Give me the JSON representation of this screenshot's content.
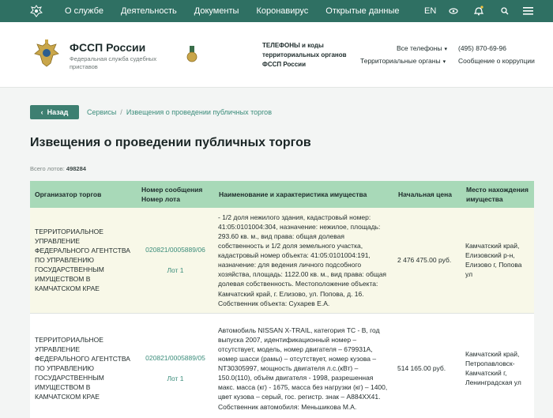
{
  "nav": {
    "items": [
      "О службе",
      "Деятельность",
      "Документы",
      "Коронавирус",
      "Открытые данные"
    ],
    "lang": "EN"
  },
  "header": {
    "org_name": "ФССП России",
    "org_sub": "Федеральная служба судебных приставов",
    "phones_title": "ТЕЛЕФОНЫ и коды территориальных органов ФССП России",
    "all_phones": "Все телефоны",
    "territorial": "Территориальные органы",
    "phone": "(495) 870-69-96",
    "report": "Сообщение о коррупции"
  },
  "breadcrumb": {
    "back": "Назад",
    "items": [
      "Сервисы",
      "Извещения о проведении публичных торгов"
    ]
  },
  "page": {
    "title": "Извещения о проведении публичных торгов",
    "total_label": "Всего лотов:",
    "total_value": "498284"
  },
  "table": {
    "headers": [
      "Организатор торгов",
      "Номер сообщения Номер лота",
      "Наименование и характеристика имущества",
      "Начальная цена",
      "Место нахождения имущества"
    ],
    "rows": [
      {
        "organizer": "Территориальное управление Федерального агентства по управлению государственным имуществом в Камчатском крае",
        "message_no": "020821/0005889/06",
        "lot": "Лот 1",
        "description": "- 1/2 доля нежилого здания, кадастровый номер: 41:05:0101004:304, назначение: нежилое, площадь: 293.60 кв. м., вид права: общая долевая собственность и 1/2 доля земельного участка, кадастровый номер объекта: 41:05:0101004:191, назначение: для ведения личного подсобного хозяйства, площадь: 1122.00 кв. м., вид права: общая долевая собственность. Местоположение объекта: Камчатский край, г. Елизово, ул. Попова, д. 16. Собственник объекта: Сухарев Е.А.",
        "price": "2 476 475.00 руб.",
        "location": "Камчатский край, Елизовский р-н, Елизово г, Попова ул"
      },
      {
        "organizer": "Территориальное управление Федерального агентства по управлению государственным имуществом в Камчатском крае",
        "message_no": "020821/0005889/05",
        "lot": "Лот 1",
        "description": "Автомобиль NISSAN X-TRAIL, категория ТС - В, год выпуска 2007, идентификационный номер – отсутствует, модель, номер двигателя – 679931А, номер шасси (рамы) – отсутствует, номер кузова – NT30305997, мощность двигателя л.с.(кВт) – 150.0(110), объём двигателя - 1998, разрешенная макс. масса (кг) - 1675, масса без нагрузки (кг) – 1400, цвет кузова – серый, гос. регистр. знак – А884ХХ41. Собственник автомобиля: Меньшикова М.А.",
        "price": "514 165.00 руб.",
        "location": "Камчатский край, Петропавловск-Камчатский г, Ленинградская ул"
      }
    ]
  }
}
